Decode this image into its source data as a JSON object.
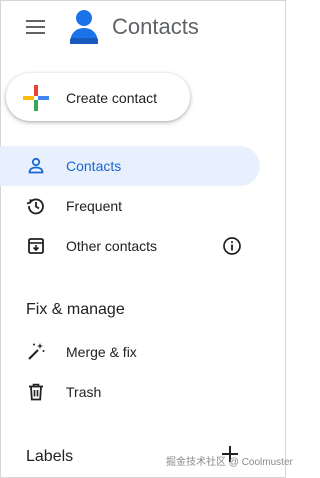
{
  "app": {
    "title": "Contacts"
  },
  "create": {
    "label": "Create contact"
  },
  "nav": {
    "contacts": "Contacts",
    "frequent": "Frequent",
    "other": "Other contacts"
  },
  "fix_manage": {
    "title": "Fix & manage",
    "merge": "Merge & fix",
    "trash": "Trash"
  },
  "labels": {
    "title": "Labels"
  },
  "watermark": "掘金技术社区 @ Coolmuster",
  "colors": {
    "active_bg": "#e8f0fe",
    "active_text": "#1967d2",
    "icon_gray": "#5f6368",
    "logo_blue": "#1a73e8"
  },
  "icons": [
    "hamburger-menu-icon",
    "contacts-logo-icon",
    "multicolor-plus-icon",
    "person-icon",
    "history-icon",
    "archive-download-icon",
    "info-icon",
    "magic-wand-icon",
    "trash-icon",
    "plus-icon"
  ]
}
